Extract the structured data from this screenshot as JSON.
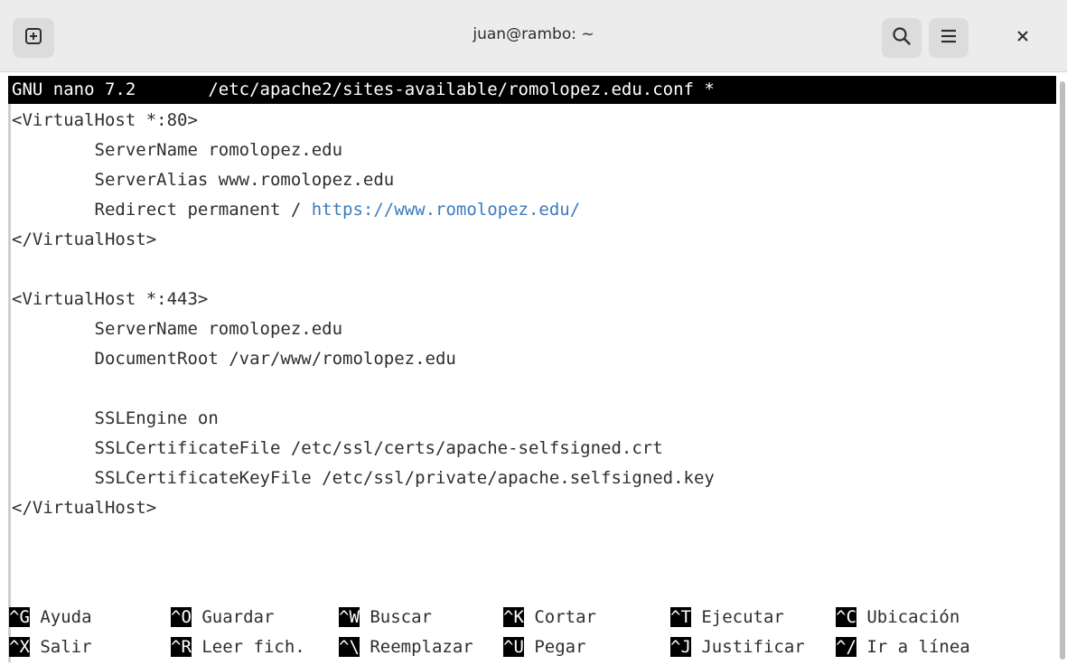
{
  "window": {
    "title": "juan@rambo: ~"
  },
  "icons": {
    "new_tab": "plus-square-icon",
    "search": "search-icon",
    "menu": "hamburger-menu-icon",
    "close": "close-icon"
  },
  "nano": {
    "version": "GNU nano 7.2",
    "filename": "/etc/apache2/sites-available/romolopez.edu.conf *"
  },
  "file_lines": [
    "<VirtualHost *:80>",
    "        ServerName romolopez.edu",
    "        ServerAlias www.romolopez.edu",
    "        Redirect permanent / ",
    "</VirtualHost>",
    "",
    "<VirtualHost *:443>",
    "        ServerName romolopez.edu",
    "        DocumentRoot /var/www/romolopez.edu",
    "",
    "        SSLEngine on",
    "        SSLCertificateFile /etc/ssl/certs/apache-selfsigned.crt",
    "        SSLCertificateKeyFile /etc/ssl/private/apache.selfsigned.key",
    "</VirtualHost>"
  ],
  "redirect_url": "https://www.romolopez.edu/",
  "shortcuts": {
    "row1": [
      {
        "key": "^G",
        "label": "Ayuda"
      },
      {
        "key": "^O",
        "label": "Guardar"
      },
      {
        "key": "^W",
        "label": "Buscar"
      },
      {
        "key": "^K",
        "label": "Cortar"
      },
      {
        "key": "^T",
        "label": "Ejecutar"
      },
      {
        "key": "^C",
        "label": "Ubicación"
      }
    ],
    "row2": [
      {
        "key": "^X",
        "label": "Salir"
      },
      {
        "key": "^R",
        "label": "Leer fich."
      },
      {
        "key": "^\\",
        "label": "Reemplazar"
      },
      {
        "key": "^U",
        "label": "Pegar"
      },
      {
        "key": "^J",
        "label": "Justificar"
      },
      {
        "key": "^/",
        "label": "Ir a línea"
      }
    ]
  },
  "colors": {
    "header_bg": "#ececec",
    "terminal_bg": "#ffffff",
    "terminal_fg": "#2e2e2e",
    "url": "#3b7bbd",
    "nano_bar_bg": "#000000",
    "nano_bar_fg": "#ffffff"
  }
}
